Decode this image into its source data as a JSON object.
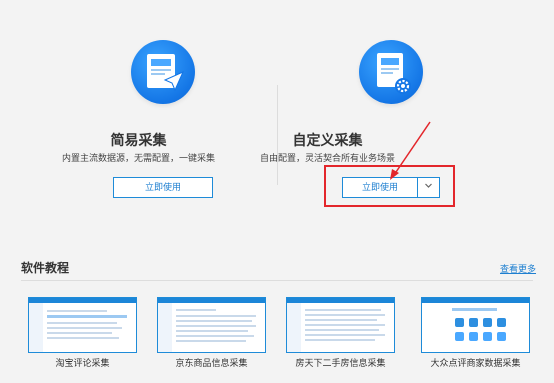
{
  "simple": {
    "title": "简易采集",
    "subtitle": "内置主流数据源，无需配置，一键采集",
    "button": "立即使用"
  },
  "custom": {
    "title": "自定义采集",
    "subtitle": "自由配置，灵活契合所有业务场景",
    "button": "立即使用",
    "dropdown_icon": "chevron-down-icon"
  },
  "tutorials": {
    "title": "软件教程",
    "more": "查看更多",
    "items": [
      {
        "label": "淘宝评论采集"
      },
      {
        "label": "京东商品信息采集"
      },
      {
        "label": "房天下二手房信息采集"
      },
      {
        "label": "大众点评商家数据采集"
      }
    ]
  },
  "colors": {
    "accent": "#1e8bd8",
    "highlight": "#e3262b"
  }
}
